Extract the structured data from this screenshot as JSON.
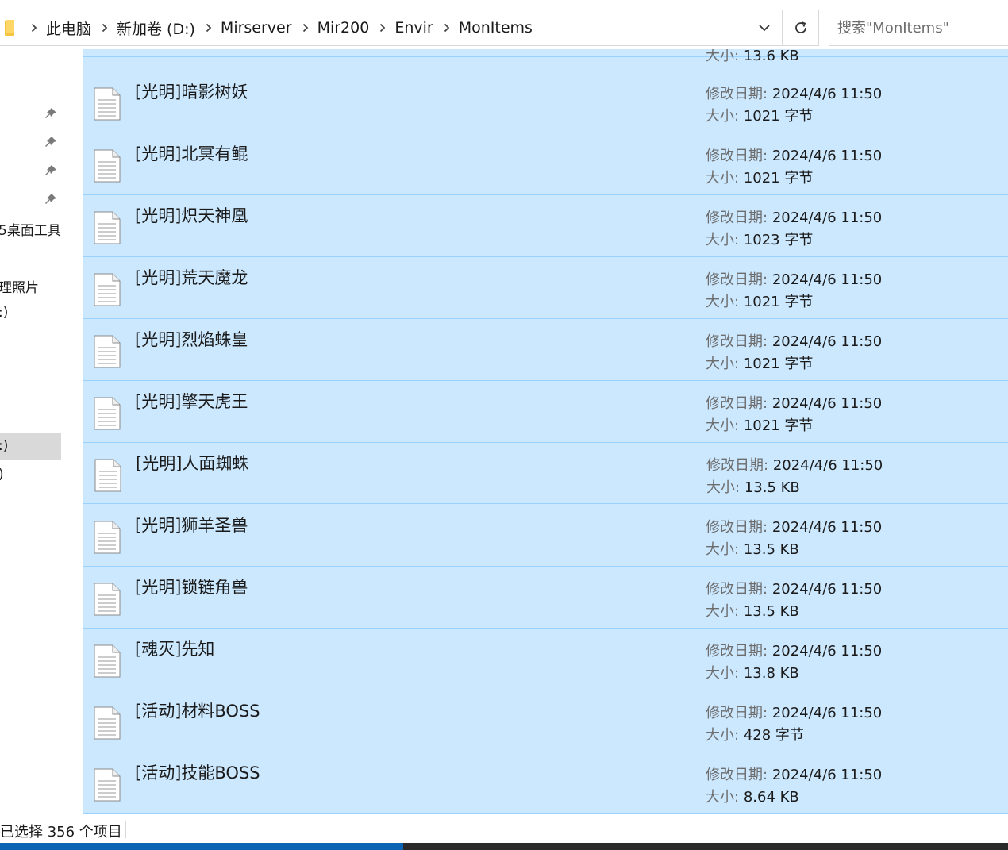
{
  "address_bar": {
    "breadcrumbs": [
      "此电脑",
      "新加卷 (D:)",
      "Mirserver",
      "Mir200",
      "Envir",
      "MonItems"
    ]
  },
  "search": {
    "placeholder": "搜索\"MonItems\""
  },
  "nav": {
    "items": [
      "5桌面工具",
      "理照片",
      ":)",
      ":)",
      ")"
    ]
  },
  "file_list": {
    "date_label": "修改日期:",
    "size_label": "大小:",
    "partial_top": {
      "size": "13.6 KB"
    },
    "files": [
      {
        "name": "[光明]暗影树妖",
        "modified": "2024/4/6 11:50",
        "size": "1021 字节"
      },
      {
        "name": "[光明]北冥有鲲",
        "modified": "2024/4/6 11:50",
        "size": "1021 字节"
      },
      {
        "name": "[光明]炽天神凰",
        "modified": "2024/4/6 11:50",
        "size": "1023 字节"
      },
      {
        "name": "[光明]荒天魔龙",
        "modified": "2024/4/6 11:50",
        "size": "1021 字节"
      },
      {
        "name": "[光明]烈焰蛛皇",
        "modified": "2024/4/6 11:50",
        "size": "1021 字节"
      },
      {
        "name": "[光明]擎天虎王",
        "modified": "2024/4/6 11:50",
        "size": "1021 字节"
      },
      {
        "name": "[光明]人面蜘蛛",
        "modified": "2024/4/6 11:50",
        "size": "13.5 KB"
      },
      {
        "name": "[光明]狮羊圣兽",
        "modified": "2024/4/6 11:50",
        "size": "13.5 KB"
      },
      {
        "name": "[光明]锁链角兽",
        "modified": "2024/4/6 11:50",
        "size": "13.5 KB"
      },
      {
        "name": "[魂灭]先知",
        "modified": "2024/4/6 11:50",
        "size": "13.8 KB"
      },
      {
        "name": "[活动]材料BOSS",
        "modified": "2024/4/6 11:50",
        "size": "428 字节"
      },
      {
        "name": "[活动]技能BOSS",
        "modified": "2024/4/6 11:50",
        "size": "8.64 KB"
      }
    ]
  },
  "status_bar": {
    "selection_text": "已选择 356 个项目"
  },
  "colors": {
    "selection_bg": "#cce8ff",
    "selection_border": "#99d1ff",
    "accent": "#0078d7"
  }
}
